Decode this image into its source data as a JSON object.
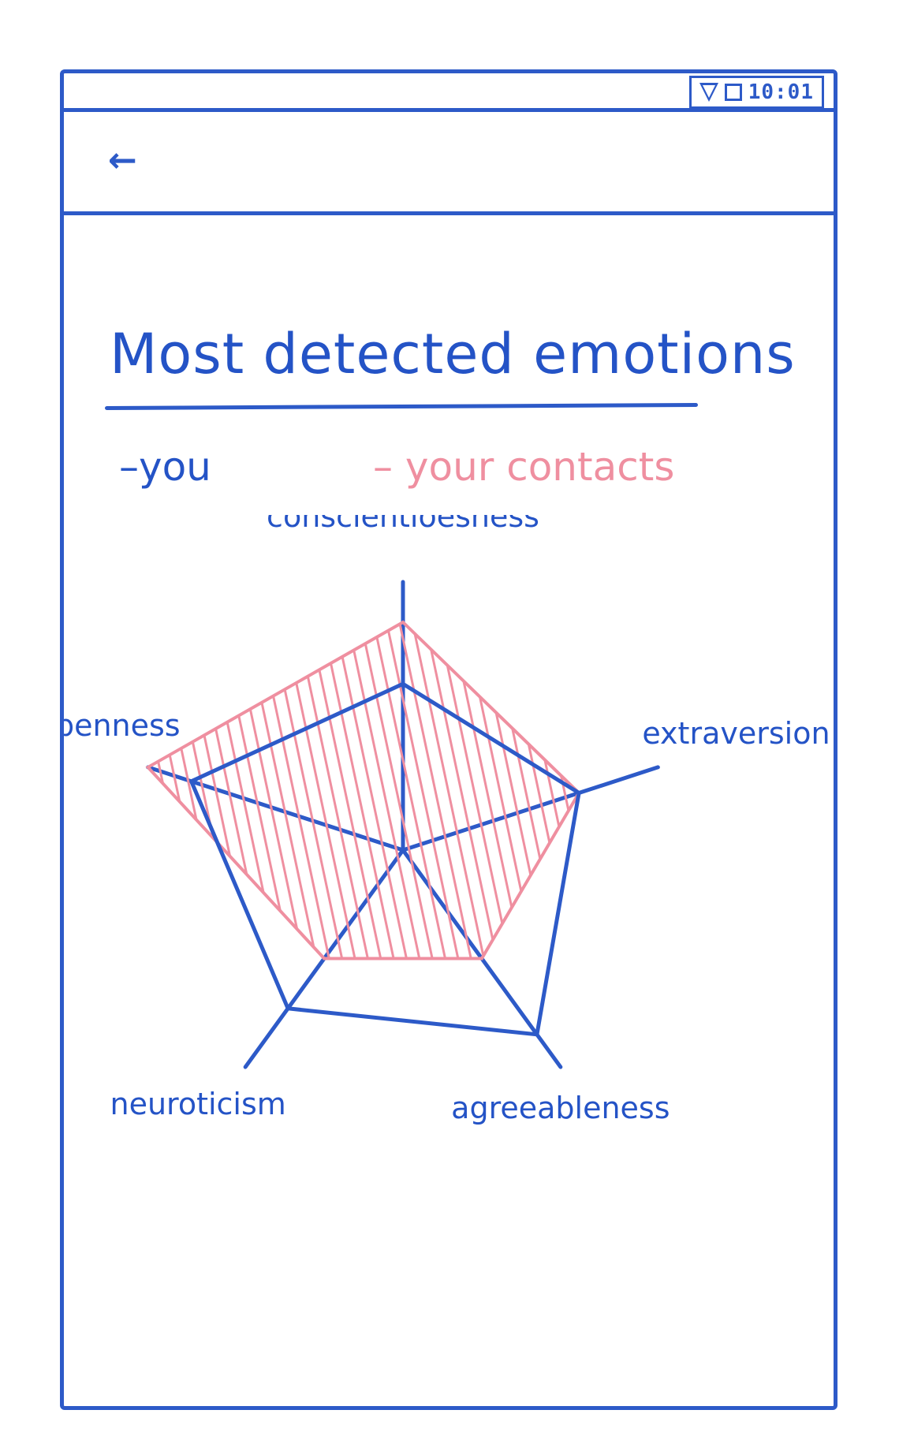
{
  "status_bar": {
    "time": "10:01",
    "icons": [
      "wifi-icon",
      "battery-icon"
    ]
  },
  "app_bar": {
    "back_icon": "back-arrow-icon",
    "back_glyph": "←"
  },
  "page": {
    "title": "Most detected emotions",
    "legend": {
      "you": "–you",
      "contacts": "– your contacts"
    }
  },
  "colors": {
    "you": "#2d5ac8",
    "contacts": "#ef8fa0"
  },
  "chart_data": {
    "type": "radar",
    "axes": [
      "conscientiousness",
      "extraversion",
      "agreeableness",
      "neuroticism",
      "openness"
    ],
    "axis_labels": [
      "conscientioesness",
      "extraversion",
      "agreeableness",
      "neuroticism",
      "openness"
    ],
    "max": 1,
    "grid": false,
    "series": [
      {
        "name": "you",
        "values": [
          0.62,
          0.69,
          0.85,
          0.73,
          0.83
        ]
      },
      {
        "name": "your contacts",
        "values": [
          0.85,
          0.69,
          0.5,
          0.5,
          1.0
        ]
      }
    ]
  }
}
